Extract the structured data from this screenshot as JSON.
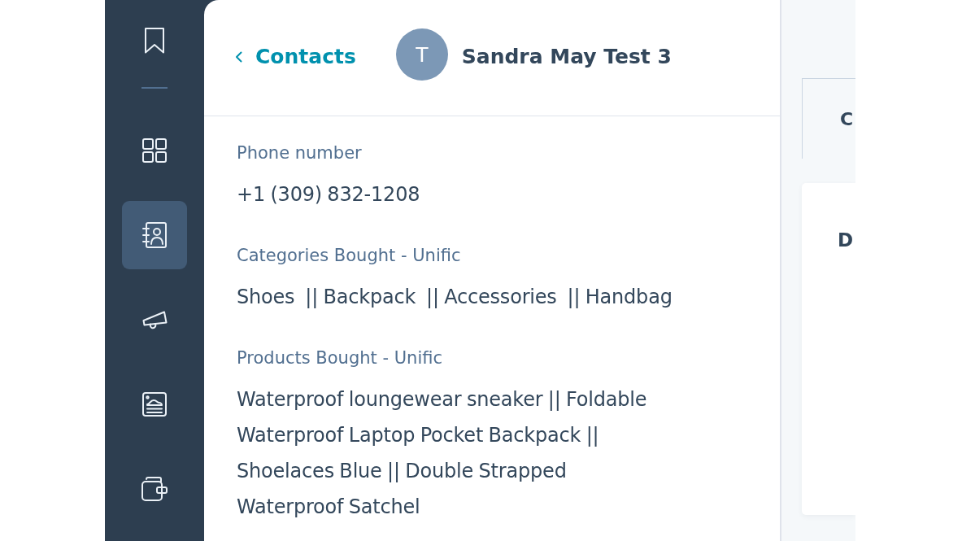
{
  "sidebar": {
    "items": [
      {
        "selected": false
      },
      {
        "selected": false
      },
      {
        "selected": true
      },
      {
        "selected": false
      },
      {
        "selected": false
      },
      {
        "selected": false
      }
    ]
  },
  "header": {
    "back_link": "Contacts",
    "avatar_initial": "T",
    "contact_name": "Sandra May Test 3"
  },
  "properties": [
    {
      "label": "Phone number",
      "value": "+1 (309) 832-1208"
    },
    {
      "label": "Categories Bought - Unific",
      "value": "Shoes  || Backpack  || Accessories  || Handbag"
    },
    {
      "label": "Products Bought - Unific",
      "value": "Waterproof loungewear sneaker || Foldable Waterproof Laptop Pocket Backpack || Shoelaces Blue || Double Strapped Waterproof Satchel"
    }
  ],
  "side_panel": {
    "tabs": [
      {
        "label": "C",
        "selected": true
      }
    ],
    "card": {
      "title": "D"
    }
  }
}
